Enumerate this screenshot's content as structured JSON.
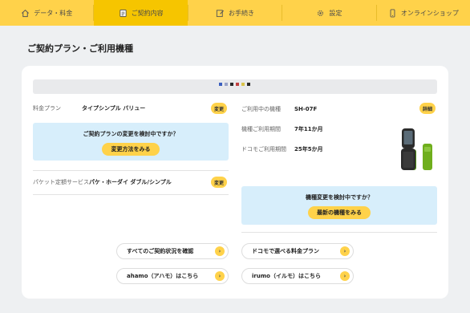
{
  "nav": {
    "items": [
      {
        "label": "データ・料金",
        "icon": "home-icon"
      },
      {
        "label": "ご契約内容",
        "icon": "document-icon"
      },
      {
        "label": "お手続き",
        "icon": "edit-icon"
      },
      {
        "label": "設定",
        "icon": "gear-icon"
      },
      {
        "label": "オンラインショップ",
        "icon": "smartphone-icon"
      }
    ],
    "active_index": 1
  },
  "page_title": "ご契約プラン・ご利用機種",
  "plan": {
    "fee_plan_label": "料金プラン",
    "fee_plan_value": "タイプシンプル バリュー",
    "change_label": "変更",
    "plan_question": "ご契約プランの変更を検討中ですか？",
    "plan_change_button": "変更方法をみる",
    "packet_label": "パケット定額サービス",
    "packet_value": "パケ・ホーダイ ダブル/シンプル",
    "packet_change_label": "変更"
  },
  "device": {
    "model_label": "ご利用中の機種",
    "model_value": "SH-07F",
    "detail_label": "詳細",
    "usage_period_label": "機種ご利用期間",
    "usage_period_value": "7年11か月",
    "docomo_period_label": "ドコモご利用期間",
    "docomo_period_value": "25年5か月",
    "device_question": "機種変更を検討中ですか？",
    "latest_device_button": "最新の機種をみる"
  },
  "links": [
    {
      "label": "すべてのご契約状況を確認"
    },
    {
      "label": "ドコモで選べる料金プラン"
    },
    {
      "label": "ahamo（アハモ）はこちら"
    },
    {
      "label": "irumo（イルモ）はこちら"
    }
  ],
  "colors": {
    "accent": "#ffd24a",
    "info_box": "#d7eefb",
    "phone_body": "#6fae1c"
  }
}
